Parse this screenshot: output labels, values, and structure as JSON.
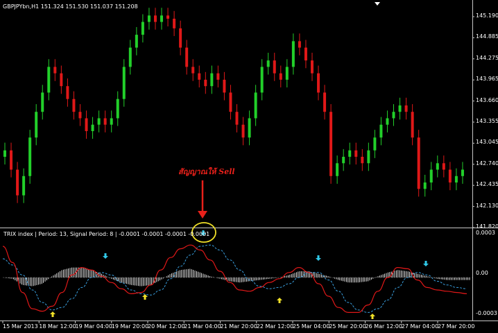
{
  "header": {
    "symbol_line": "GBPJPYbn,H1  151.324 151.530 151.037 151.208"
  },
  "indicator": {
    "label": "TRIX index | Period: 13, Signal Period: 8 |  -0.0001 -0.0001 -0.0001 -0.0001"
  },
  "annotation": {
    "text": "สัญญาณให้ Sell",
    "arrow_color": "#e8201a",
    "circle_color": "#f0e028"
  },
  "price_axis": [
    "145.190",
    "144.885",
    "144.275",
    "143.965",
    "143.660",
    "143.355",
    "143.045",
    "142.740",
    "142.435",
    "142.130",
    "141.820"
  ],
  "indicator_axis": [
    "0.0003",
    "0.00",
    "-0.0003"
  ],
  "time_axis": [
    "15 Mar 2013",
    "18 Mar 12:00",
    "19 Mar 04:00",
    "19 Mar 20:00",
    "20 Mar 12:00",
    "21 Mar 04:00",
    "21 Mar 20:00",
    "22 Mar 12:00",
    "25 Mar 04:00",
    "25 Mar 20:00",
    "26 Mar 12:00",
    "27 Mar 04:00",
    "27 Mar 20:00"
  ],
  "colors": {
    "bull": "#22d02a",
    "bear": "#e01818",
    "trix": "#e01818",
    "signal": "#3aa0e0",
    "histogram": "#ffffff",
    "buy_arrow": "#f0e028",
    "sell_arrow": "#30c8e8"
  },
  "chart_data": [
    {
      "type": "candlestick",
      "title": "GBPJPYbn,H1",
      "ylim": [
        141.82,
        145.19
      ],
      "close": [
        143.0,
        142.7,
        142.3,
        142.6,
        143.2,
        143.6,
        143.9,
        144.3,
        144.2,
        144.0,
        143.8,
        143.6,
        143.5,
        143.3,
        143.4,
        143.5,
        143.4,
        143.5,
        143.8,
        144.3,
        144.6,
        144.8,
        145.0,
        145.1,
        145.0,
        145.1,
        145.05,
        144.9,
        144.6,
        144.3,
        144.2,
        144.1,
        144.0,
        144.2,
        144.1,
        143.9,
        143.6,
        143.4,
        143.2,
        143.5,
        143.9,
        144.3,
        144.4,
        144.2,
        144.1,
        144.3,
        144.7,
        144.6,
        144.4,
        144.2,
        143.9,
        143.6,
        142.6,
        142.8,
        142.9,
        143.0,
        142.9,
        142.8,
        143.0,
        143.2,
        143.4,
        143.5,
        143.6,
        143.7,
        143.6,
        143.2,
        142.4,
        142.5,
        142.7,
        142.8,
        142.7,
        142.5,
        142.6,
        142.7
      ]
    },
    {
      "type": "line",
      "title": "TRIX index",
      "ylim": [
        -0.0003,
        0.0003
      ],
      "series": [
        {
          "values": [
            0.00025,
            0.00012,
            -0.00012,
            -0.00025,
            -0.00027,
            -0.00023,
            -0.00012,
            2e-05,
            8e-05,
            6e-05,
            1e-05,
            -4e-05,
            -9e-05,
            -0.00013,
            -0.00012,
            -6e-05,
            6e-05,
            0.00016,
            0.00023,
            0.00026,
            0.00022,
            0.00014,
            5e-05,
            -4e-05,
            -0.0001,
            -0.00011,
            -8e-05,
            -4e-05,
            -1e-05,
            4e-05,
            8e-05,
            4e-05,
            -5e-05,
            -0.00015,
            -0.00024,
            -0.00028,
            -0.00028,
            -0.00022,
            -0.00011,
            0.0,
            8e-05,
            7e-05,
            -2e-05,
            -8e-05,
            -0.0001,
            -0.00011,
            -0.00012,
            -0.00013
          ]
        },
        {
          "values": [
            0.00015,
            0.0001,
            2e-05,
            -0.0001,
            -0.0002,
            -0.00026,
            -0.00024,
            -0.00017,
            -8e-05,
            0.0,
            4e-05,
            2e-05,
            -4e-05,
            -0.0001,
            -0.00013,
            -0.00014,
            -0.0001,
            -1e-05,
            9e-05,
            0.00018,
            0.00025,
            0.00026,
            0.00022,
            0.00014,
            6e-05,
            -2e-05,
            -7e-05,
            -9e-05,
            -8e-05,
            -5e-05,
            0.0,
            4e-05,
            4e-05,
            -2e-05,
            -0.00011,
            -0.0002,
            -0.00026,
            -0.00028,
            -0.00025,
            -0.00018,
            -8e-05,
            0.0,
            4e-05,
            2e-05,
            -3e-05,
            -6e-05,
            -8e-05,
            -9e-05
          ]
        },
        {
          "values": [
            0.0,
            -1e-05,
            -6e-05,
            -7e-05,
            -5e-05,
            1e-05,
            6e-05,
            8e-05,
            8e-05,
            6e-05,
            3e-05,
            -1e-05,
            -4e-05,
            -6e-05,
            -7e-05,
            -6e-05,
            -2e-05,
            3e-05,
            6e-05,
            7e-05,
            4e-05,
            1e-05,
            -1e-05,
            -3e-05,
            -4e-05,
            -3e-05,
            -2e-05,
            -1e-05,
            0.0,
            2e-05,
            5e-05,
            5e-05,
            3e-05,
            1e-05,
            -2e-05,
            -4e-05,
            -4e-05,
            -3e-05,
            1e-05,
            4e-05,
            6e-05,
            5e-05,
            3e-05,
            1e-05,
            -1e-05,
            -2e-05,
            -2e-05,
            -2e-05
          ]
        }
      ]
    }
  ]
}
